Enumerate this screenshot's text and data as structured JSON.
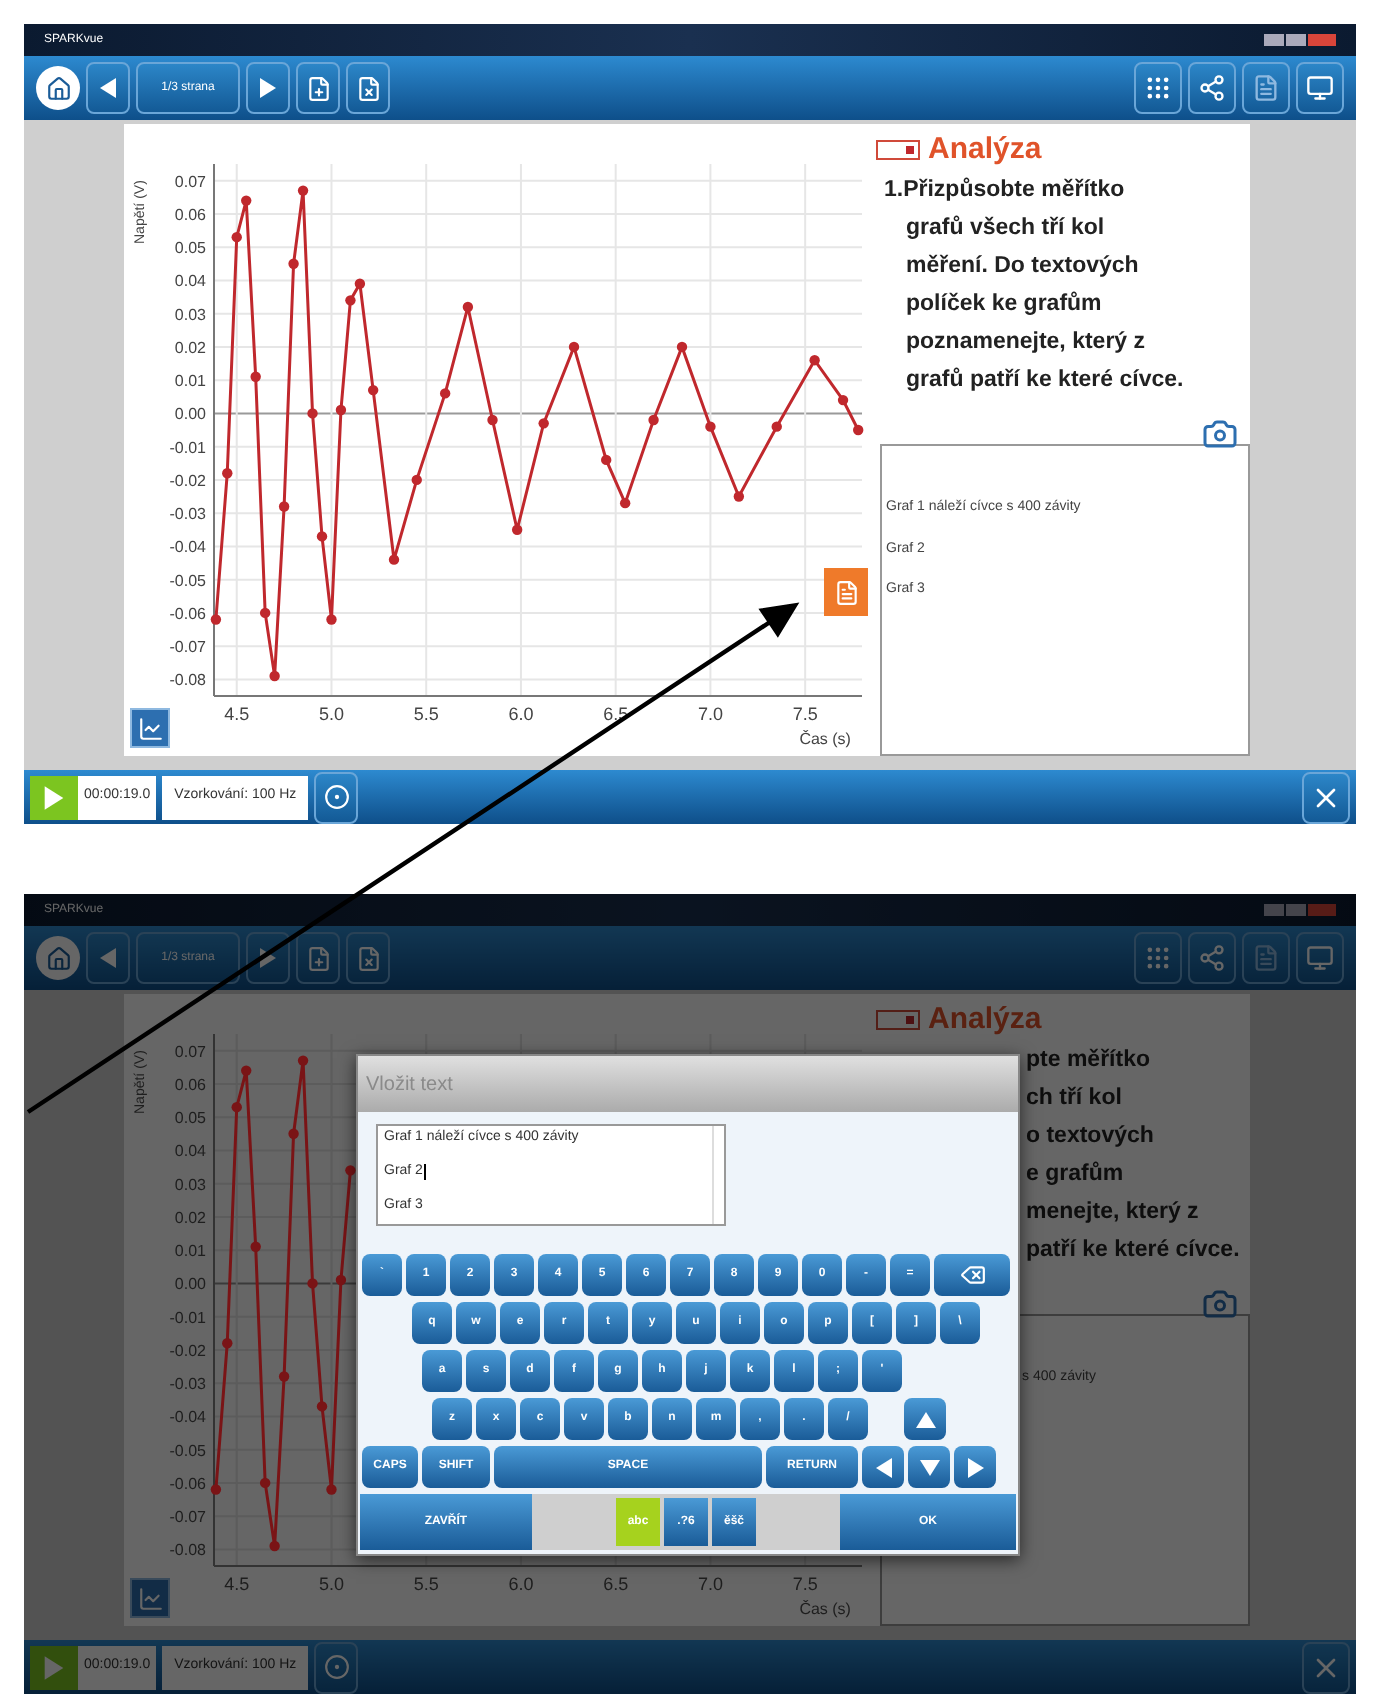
{
  "screens": [
    {
      "title": "SPARKvue",
      "page_label": "1/3 strana",
      "dimmed": false,
      "chart": {
        "chart_data": {
          "type": "line",
          "grid": true,
          "xlabel": "Čas (s)",
          "ylabel": "Napětí (V)",
          "xlim": [
            4.38,
            7.8
          ],
          "ylim": [
            -0.085,
            0.075
          ],
          "xticks": [
            {
              "value": 4.5,
              "label": "4.5"
            },
            {
              "value": 5,
              "label": "5.0"
            },
            {
              "value": 5.5,
              "label": "5.5"
            },
            {
              "value": 6,
              "label": "6.0"
            },
            {
              "value": 6.5,
              "label": "6.5"
            },
            {
              "value": 7,
              "label": "7.0"
            },
            {
              "value": 7.5,
              "label": "7.5"
            }
          ],
          "yticks": [
            {
              "value": 0.07,
              "label": "0.07"
            },
            {
              "value": 0.06,
              "label": "0.06"
            },
            {
              "value": 0.05,
              "label": "0.05"
            },
            {
              "value": 0.04,
              "label": "0.04"
            },
            {
              "value": 0.03,
              "label": "0.03"
            },
            {
              "value": 0.02,
              "label": "0.02"
            },
            {
              "value": 0.01,
              "label": "0.01"
            },
            {
              "value": 0,
              "label": "0.00"
            },
            {
              "value": -0.01,
              "label": "-0.01"
            },
            {
              "value": -0.02,
              "label": "-0.02"
            },
            {
              "value": -0.03,
              "label": "-0.03"
            },
            {
              "value": -0.04,
              "label": "-0.04"
            },
            {
              "value": -0.05,
              "label": "-0.05"
            },
            {
              "value": -0.06,
              "label": "-0.06"
            },
            {
              "value": -0.07,
              "label": "-0.07"
            },
            {
              "value": -0.08,
              "label": "-0.08"
            }
          ],
          "x": [
            4.39,
            4.45,
            4.5,
            4.55,
            4.6,
            4.65,
            4.7,
            4.75,
            4.8,
            4.85,
            4.9,
            4.95,
            5.0,
            5.05,
            5.1,
            5.15,
            5.22,
            5.33,
            5.45,
            5.6,
            5.72,
            5.85,
            5.98,
            6.12,
            6.28,
            6.45,
            6.55,
            6.7,
            6.85,
            7.0,
            7.15,
            7.35,
            7.55,
            7.7,
            7.78
          ],
          "series": [
            {
              "color": "#c0282d",
              "marker": true,
              "values": [
                -0.062,
                -0.018,
                0.053,
                0.064,
                0.011,
                -0.06,
                -0.079,
                -0.028,
                0.045,
                0.067,
                0.0,
                -0.037,
                -0.062,
                0.001,
                0.034,
                0.039,
                0.007,
                -0.044,
                -0.02,
                0.006,
                0.032,
                -0.002,
                -0.035,
                -0.003,
                0.02,
                -0.014,
                -0.027,
                -0.002,
                0.02,
                -0.004,
                -0.025,
                -0.004,
                0.016,
                0.004,
                -0.005
              ]
            }
          ]
        }
      },
      "analysis": {
        "heading": "Analýza",
        "lines": [
          "1.Přizpůsobte měřítko",
          "grafů všech tří kol",
          "měření. Do textových",
          "políček ke grafům",
          "poznamenejte, který z",
          "grafů patří ke které cívce."
        ]
      },
      "notes": [
        "Graf 1 náleží cívce s 400 závity",
        "Graf 2",
        "Graf 3"
      ],
      "status": {
        "time": "00:00:19.0",
        "sampling": "Vzorkování: 100 Hz"
      }
    },
    {
      "title": "SPARKvue",
      "page_label": "1/3 strana",
      "dimmed": true,
      "chart": {
        "chart_data": {
          "type": "line",
          "grid": true,
          "xlabel": "Čas (s)",
          "ylabel": "Napětí (V)",
          "xlim": [
            4.38,
            7.8
          ],
          "ylim": [
            -0.085,
            0.075
          ],
          "xticks": [
            {
              "value": 4.5,
              "label": "4.5"
            },
            {
              "value": 5,
              "label": "5.0"
            },
            {
              "value": 5.5,
              "label": "5.5"
            },
            {
              "value": 6,
              "label": "6.0"
            },
            {
              "value": 6.5,
              "label": "6.5"
            },
            {
              "value": 7,
              "label": "7.0"
            },
            {
              "value": 7.5,
              "label": "7.5"
            }
          ],
          "yticks": [
            {
              "value": 0.07,
              "label": "0.07"
            },
            {
              "value": 0.06,
              "label": "0.06"
            },
            {
              "value": 0.05,
              "label": "0.05"
            },
            {
              "value": 0.04,
              "label": "0.04"
            },
            {
              "value": 0.03,
              "label": "0.03"
            },
            {
              "value": 0.02,
              "label": "0.02"
            },
            {
              "value": 0.01,
              "label": "0.01"
            },
            {
              "value": 0,
              "label": "0.00"
            },
            {
              "value": -0.01,
              "label": "-0.01"
            },
            {
              "value": -0.02,
              "label": "-0.02"
            },
            {
              "value": -0.03,
              "label": "-0.03"
            },
            {
              "value": -0.04,
              "label": "-0.04"
            },
            {
              "value": -0.05,
              "label": "-0.05"
            },
            {
              "value": -0.06,
              "label": "-0.06"
            },
            {
              "value": -0.07,
              "label": "-0.07"
            },
            {
              "value": -0.08,
              "label": "-0.08"
            }
          ],
          "x": [
            4.39,
            4.45,
            4.5,
            4.55,
            4.6,
            4.65,
            4.7,
            4.75,
            4.8,
            4.85,
            4.9,
            4.95,
            5.0,
            5.05,
            5.1
          ],
          "series": [
            {
              "color": "#7a1416",
              "marker": true,
              "values": [
                -0.062,
                -0.018,
                0.053,
                0.064,
                0.011,
                -0.06,
                -0.079,
                -0.028,
                0.045,
                0.067,
                0.0,
                -0.037,
                -0.062,
                0.001,
                0.034
              ]
            }
          ]
        }
      },
      "analysis": {
        "heading": "Analýza",
        "lines": [
          "pte měřítko",
          "ch tří kol",
          "o textových",
          "e grafům",
          "menejte, který z",
          "patří ke které cívce."
        ]
      },
      "notes": [
        "s 400 závity"
      ],
      "status": {
        "time": "00:00:19.0",
        "sampling": "Vzorkování: 100 Hz"
      },
      "dialog": {
        "title": "Vložit text",
        "text_lines": [
          {
            "text": "Graf 1 náleží cívce s 400 závity",
            "caret": false
          },
          {
            "text": "Graf 2",
            "caret": true
          },
          {
            "text": "Graf 3",
            "caret": false
          }
        ],
        "key_rows": [
          {
            "keys": [
              {
                "kind": "char",
                "label": "`"
              },
              {
                "kind": "char",
                "label": "1"
              },
              {
                "kind": "char",
                "label": "2"
              },
              {
                "kind": "char",
                "label": "3"
              },
              {
                "kind": "char",
                "label": "4"
              },
              {
                "kind": "char",
                "label": "5"
              },
              {
                "kind": "char",
                "label": "6"
              },
              {
                "kind": "char",
                "label": "7"
              },
              {
                "kind": "char",
                "label": "8"
              },
              {
                "kind": "char",
                "label": "9"
              },
              {
                "kind": "char",
                "label": "0"
              },
              {
                "kind": "char",
                "label": "-"
              },
              {
                "kind": "char",
                "label": "="
              },
              {
                "kind": "backspace"
              }
            ]
          },
          {
            "keys": [
              {
                "kind": "char",
                "label": "q"
              },
              {
                "kind": "char",
                "label": "w"
              },
              {
                "kind": "char",
                "label": "e"
              },
              {
                "kind": "char",
                "label": "r"
              },
              {
                "kind": "char",
                "label": "t"
              },
              {
                "kind": "char",
                "label": "y"
              },
              {
                "kind": "char",
                "label": "u"
              },
              {
                "kind": "char",
                "label": "i"
              },
              {
                "kind": "char",
                "label": "o"
              },
              {
                "kind": "char",
                "label": "p"
              },
              {
                "kind": "char",
                "label": "["
              },
              {
                "kind": "char",
                "label": "]"
              },
              {
                "kind": "char",
                "label": "\\"
              }
            ]
          },
          {
            "keys": [
              {
                "kind": "char",
                "label": "a"
              },
              {
                "kind": "char",
                "label": "s"
              },
              {
                "kind": "char",
                "label": "d"
              },
              {
                "kind": "char",
                "label": "f"
              },
              {
                "kind": "char",
                "label": "g"
              },
              {
                "kind": "char",
                "label": "h"
              },
              {
                "kind": "char",
                "label": "j"
              },
              {
                "kind": "char",
                "label": "k"
              },
              {
                "kind": "char",
                "label": "l"
              },
              {
                "kind": "char",
                "label": ";"
              },
              {
                "kind": "char",
                "label": "'"
              }
            ]
          },
          {
            "keys": [
              {
                "kind": "char",
                "label": "z"
              },
              {
                "kind": "char",
                "label": "x"
              },
              {
                "kind": "char",
                "label": "c"
              },
              {
                "kind": "char",
                "label": "v"
              },
              {
                "kind": "char",
                "label": "b"
              },
              {
                "kind": "char",
                "label": "n"
              },
              {
                "kind": "char",
                "label": "m"
              },
              {
                "kind": "char",
                "label": ","
              },
              {
                "kind": "char",
                "label": "."
              },
              {
                "kind": "char",
                "label": "/"
              },
              {
                "kind": "up"
              }
            ]
          },
          {
            "keys": [
              {
                "kind": "caps",
                "label": "CAPS"
              },
              {
                "kind": "shift",
                "label": "SHIFT"
              },
              {
                "kind": "space",
                "label": "SPACE"
              },
              {
                "kind": "return",
                "label": "RETURN"
              },
              {
                "kind": "left"
              },
              {
                "kind": "down"
              },
              {
                "kind": "right"
              }
            ]
          }
        ],
        "close_label": "ZAVŘÍT",
        "ok_label": "OK",
        "layouts": [
          {
            "label": "abc",
            "selected": true
          },
          {
            "label": ".?6",
            "selected": false
          },
          {
            "label": "ěšč",
            "selected": false
          }
        ]
      }
    }
  ]
}
